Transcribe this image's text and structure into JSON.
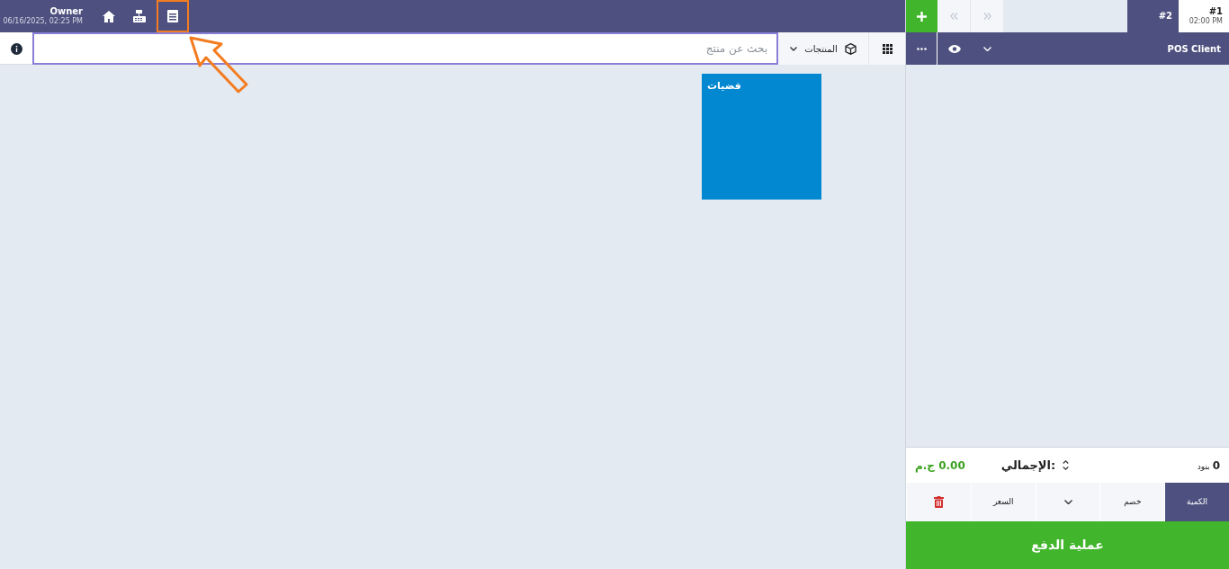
{
  "header": {
    "user": "Owner",
    "datetime": "06/16/2025, 02:25 PM"
  },
  "order_tabs": [
    {
      "label": "#1",
      "time": "02:00 PM",
      "selected": true
    },
    {
      "label": "#2",
      "selected": false
    }
  ],
  "search": {
    "placeholder": "بحث عن منتج"
  },
  "category_dropdown": {
    "label": "المنتجات"
  },
  "customer": {
    "name": "POS Client"
  },
  "categories": [
    {
      "label": "فضيات"
    }
  ],
  "summary": {
    "count": "0",
    "count_label": "بنود",
    "total_label": "الإجمالي:",
    "total": "0.00 ج.م"
  },
  "keypad_modes": [
    {
      "kind": "mode",
      "label": "الكمية",
      "selected": true
    },
    {
      "kind": "mode",
      "label": "خصم",
      "selected": false
    },
    {
      "kind": "caret",
      "selected": false
    },
    {
      "kind": "mode",
      "label": "السعر",
      "selected": false
    },
    {
      "kind": "delete",
      "selected": false
    }
  ],
  "pay_button": {
    "label": "عملية الدفع"
  }
}
